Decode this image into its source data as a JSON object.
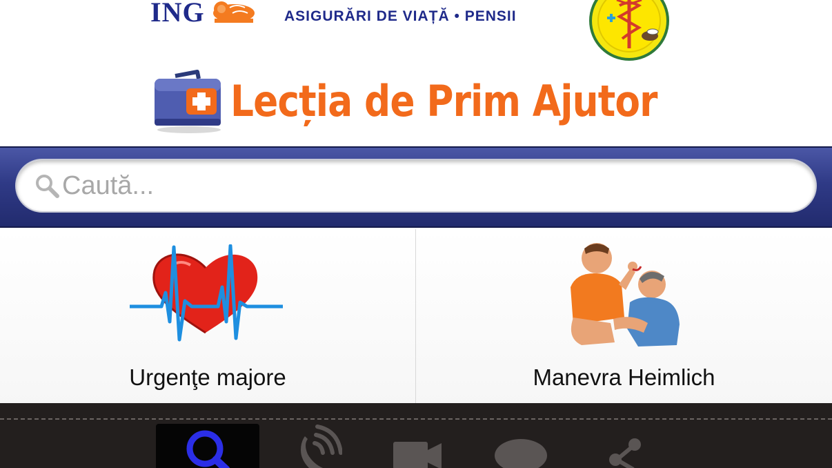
{
  "header": {
    "ing_logo_text": "ING",
    "ing_tagline": "ASIGURĂRI DE VIAȚĂ • PENSII",
    "app_title": "Lecția de Prim Ajutor"
  },
  "search": {
    "placeholder": "Caută..."
  },
  "tiles": [
    {
      "label": "Urgenţe majore",
      "icon": "heart-ecg-icon"
    },
    {
      "label": "Manevra Heimlich",
      "icon": "heimlich-maneuver-icon"
    }
  ],
  "tabbar": {
    "tabs": [
      {
        "icon": "search-icon",
        "active": true
      },
      {
        "icon": "phone-icon",
        "active": false
      },
      {
        "icon": "video-camera-icon",
        "active": false
      },
      {
        "icon": "chat-bubble-icon",
        "active": false
      },
      {
        "icon": "share-icon",
        "active": false
      }
    ],
    "colors": {
      "active": "#2b2ee6",
      "inactive": "#5a5554",
      "background": "#231f1e"
    }
  },
  "colors": {
    "brand_orange": "#f26a1b",
    "ing_blue": "#1f2a8a",
    "search_bar": "#2f3a86"
  }
}
